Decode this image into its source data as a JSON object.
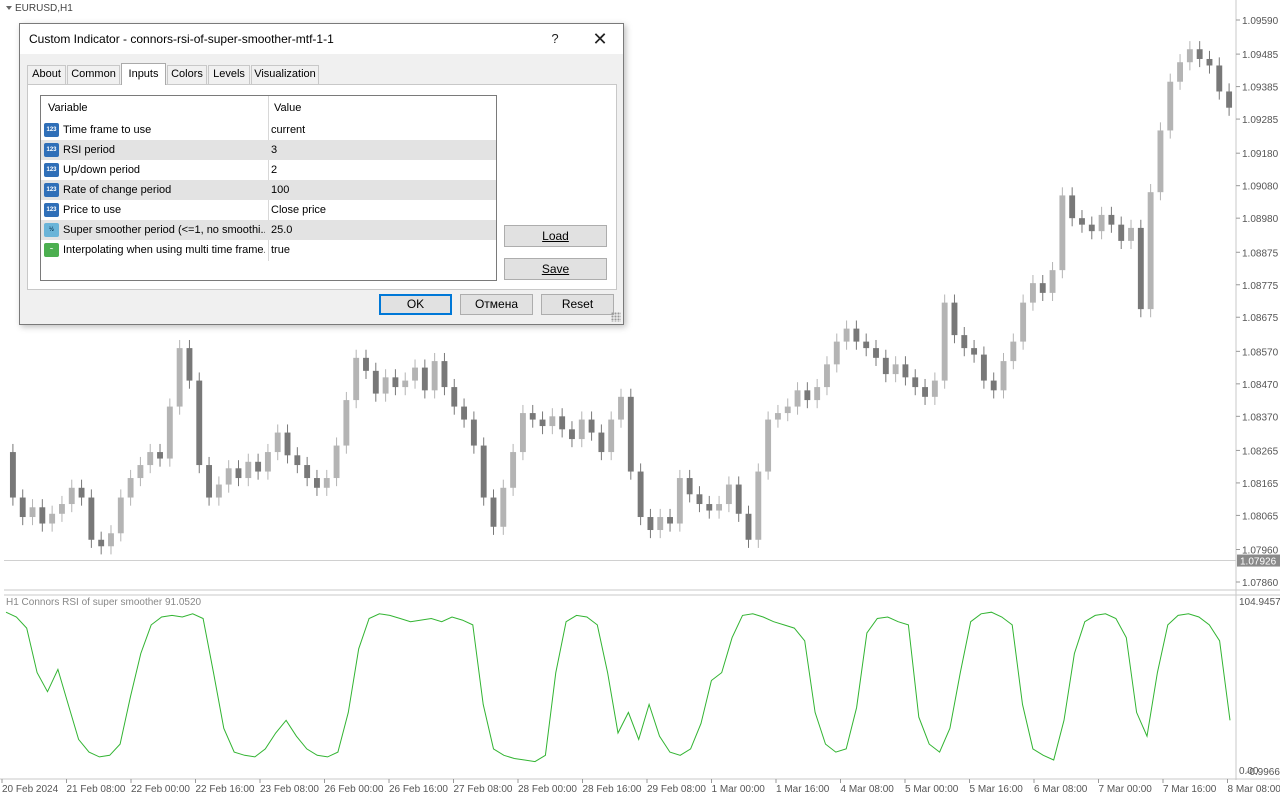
{
  "chart": {
    "symbol_label": "EURUSD,H1",
    "indicator_label": "H1 Connors RSI of super smoother 91.0520",
    "current_price": "1.07926",
    "price_min": 1.0786,
    "price_max": 1.0959,
    "candles": [
      [
        1.0826,
        1.0812
      ],
      [
        1.0812,
        1.0806
      ],
      [
        1.0806,
        1.0809
      ],
      [
        1.0809,
        1.0804
      ],
      [
        1.0804,
        1.0807
      ],
      [
        1.0807,
        1.081
      ],
      [
        1.081,
        1.0815
      ],
      [
        1.0815,
        1.0812
      ],
      [
        1.0812,
        1.0799
      ],
      [
        1.0799,
        1.0797
      ],
      [
        1.0797,
        1.0801
      ],
      [
        1.0801,
        1.0812
      ],
      [
        1.0812,
        1.0818
      ],
      [
        1.0818,
        1.0822
      ],
      [
        1.0822,
        1.0826
      ],
      [
        1.0826,
        1.0824
      ],
      [
        1.0824,
        1.084
      ],
      [
        1.084,
        1.0858
      ],
      [
        1.0858,
        1.0848
      ],
      [
        1.0848,
        1.0822
      ],
      [
        1.0822,
        1.0812
      ],
      [
        1.0812,
        1.0816
      ],
      [
        1.0816,
        1.0821
      ],
      [
        1.0821,
        1.0818
      ],
      [
        1.0818,
        1.0823
      ],
      [
        1.0823,
        1.082
      ],
      [
        1.082,
        1.0826
      ],
      [
        1.0826,
        1.0832
      ],
      [
        1.0832,
        1.0825
      ],
      [
        1.0825,
        1.0822
      ],
      [
        1.0822,
        1.0818
      ],
      [
        1.0818,
        1.0815
      ],
      [
        1.0815,
        1.0818
      ],
      [
        1.0818,
        1.0828
      ],
      [
        1.0828,
        1.0842
      ],
      [
        1.0842,
        1.0855
      ],
      [
        1.0855,
        1.0851
      ],
      [
        1.0851,
        1.0844
      ],
      [
        1.0844,
        1.0849
      ],
      [
        1.0849,
        1.0846
      ],
      [
        1.0846,
        1.0848
      ],
      [
        1.0848,
        1.0852
      ],
      [
        1.0852,
        1.0845
      ],
      [
        1.0845,
        1.0854
      ],
      [
        1.0854,
        1.0846
      ],
      [
        1.0846,
        1.084
      ],
      [
        1.084,
        1.0836
      ],
      [
        1.0836,
        1.0828
      ],
      [
        1.0828,
        1.0812
      ],
      [
        1.0812,
        1.0803
      ],
      [
        1.0803,
        1.0815
      ],
      [
        1.0815,
        1.0826
      ],
      [
        1.0826,
        1.0838
      ],
      [
        1.0838,
        1.0836
      ],
      [
        1.0836,
        1.0834
      ],
      [
        1.0834,
        1.0837
      ],
      [
        1.0837,
        1.0833
      ],
      [
        1.0833,
        1.083
      ],
      [
        1.083,
        1.0836
      ],
      [
        1.0836,
        1.0832
      ],
      [
        1.0832,
        1.0826
      ],
      [
        1.0826,
        1.0836
      ],
      [
        1.0836,
        1.0843
      ],
      [
        1.0843,
        1.082
      ],
      [
        1.082,
        1.0806
      ],
      [
        1.0806,
        1.0802
      ],
      [
        1.0802,
        1.0806
      ],
      [
        1.0806,
        1.0804
      ],
      [
        1.0804,
        1.0818
      ],
      [
        1.0818,
        1.0813
      ],
      [
        1.0813,
        1.081
      ],
      [
        1.081,
        1.0808
      ],
      [
        1.0808,
        1.081
      ],
      [
        1.081,
        1.0816
      ],
      [
        1.0816,
        1.0807
      ],
      [
        1.0807,
        1.0799
      ],
      [
        1.0799,
        1.082
      ],
      [
        1.082,
        1.0836
      ],
      [
        1.0836,
        1.0838
      ],
      [
        1.0838,
        1.084
      ],
      [
        1.084,
        1.0845
      ],
      [
        1.0845,
        1.0842
      ],
      [
        1.0842,
        1.0846
      ],
      [
        1.0846,
        1.0853
      ],
      [
        1.0853,
        1.086
      ],
      [
        1.086,
        1.0864
      ],
      [
        1.0864,
        1.086
      ],
      [
        1.086,
        1.0858
      ],
      [
        1.0858,
        1.0855
      ],
      [
        1.0855,
        1.085
      ],
      [
        1.085,
        1.0853
      ],
      [
        1.0853,
        1.0849
      ],
      [
        1.0849,
        1.0846
      ],
      [
        1.0846,
        1.0843
      ],
      [
        1.0843,
        1.0848
      ],
      [
        1.0848,
        1.0872
      ],
      [
        1.0872,
        1.0862
      ],
      [
        1.0862,
        1.0858
      ],
      [
        1.0858,
        1.0856
      ],
      [
        1.0856,
        1.0848
      ],
      [
        1.0848,
        1.0845
      ],
      [
        1.0845,
        1.0854
      ],
      [
        1.0854,
        1.086
      ],
      [
        1.086,
        1.0872
      ],
      [
        1.0872,
        1.0878
      ],
      [
        1.0878,
        1.0875
      ],
      [
        1.0875,
        1.0882
      ],
      [
        1.0882,
        1.0905
      ],
      [
        1.0905,
        1.0898
      ],
      [
        1.0898,
        1.0896
      ],
      [
        1.0896,
        1.0894
      ],
      [
        1.0894,
        1.0899
      ],
      [
        1.0899,
        1.0896
      ],
      [
        1.0896,
        1.0891
      ],
      [
        1.0891,
        1.0895
      ],
      [
        1.0895,
        1.087
      ],
      [
        1.087,
        1.0906
      ],
      [
        1.0906,
        1.0925
      ],
      [
        1.0925,
        1.094
      ],
      [
        1.094,
        1.0946
      ],
      [
        1.0946,
        1.095
      ],
      [
        1.095,
        1.0947
      ],
      [
        1.0947,
        1.0945
      ],
      [
        1.0945,
        1.0937
      ],
      [
        1.0937,
        1.0932
      ]
    ],
    "rsi": [
      98,
      95,
      88,
      60,
      48,
      62,
      40,
      18,
      10,
      7,
      8,
      15,
      45,
      72,
      90,
      95,
      96,
      95,
      97,
      94,
      60,
      25,
      10,
      8,
      7,
      12,
      22,
      30,
      20,
      12,
      8,
      7,
      10,
      35,
      75,
      94,
      97,
      96,
      94,
      92,
      93,
      94,
      92,
      95,
      93,
      90,
      40,
      12,
      8,
      6,
      5,
      4,
      8,
      60,
      92,
      96,
      95,
      90,
      60,
      22,
      35,
      18,
      40,
      20,
      10,
      8,
      12,
      28,
      55,
      60,
      82,
      96,
      97,
      95,
      92,
      90,
      88,
      80,
      35,
      15,
      10,
      12,
      38,
      85,
      94,
      95,
      92,
      90,
      32,
      15,
      10,
      25,
      60,
      92,
      97,
      98,
      95,
      90,
      40,
      12,
      8,
      5,
      30,
      72,
      92,
      96,
      97,
      94,
      82,
      35,
      20,
      60,
      90,
      96,
      97,
      95,
      90,
      80,
      30
    ],
    "x_labels": [
      "20 Feb 2024",
      "21 Feb 08:00",
      "22 Feb 00:00",
      "22 Feb 16:00",
      "23 Feb 08:00",
      "26 Feb 00:00",
      "26 Feb 16:00",
      "27 Feb 08:00",
      "28 Feb 00:00",
      "28 Feb 16:00",
      "29 Feb 08:00",
      "1 Mar 00:00",
      "1 Mar 16:00",
      "4 Mar 08:00",
      "5 Mar 00:00",
      "5 Mar 16:00",
      "6 Mar 08:00",
      "7 Mar 00:00",
      "7 Mar 16:00",
      "8 Mar 08:00"
    ],
    "y_labels": [
      "1.09590",
      "1.09485",
      "1.09385",
      "1.09285",
      "1.09180",
      "1.09080",
      "1.08980",
      "1.08875",
      "1.08775",
      "1.08675",
      "1.08570",
      "1.08470",
      "1.08370",
      "1.08265",
      "1.08165",
      "1.08065",
      "1.07960",
      "1.07860"
    ],
    "ind_y_top": "104.9457",
    "ind_y_bottom": "0.00",
    "ind_y_bottom2": "-0.9966",
    "colors": {
      "bull": "#b4b4b4",
      "bear": "#787878",
      "rsi_line": "#32b432"
    }
  },
  "dialog": {
    "title": "Custom Indicator - connors-rsi-of-super-smoother-mtf-1-1",
    "help": "?",
    "close": "✕",
    "tabs": [
      "About",
      "Common",
      "Inputs",
      "Colors",
      "Levels",
      "Visualization"
    ],
    "active_tab": "Inputs",
    "grid": {
      "col_variable": "Variable",
      "col_value": "Value",
      "rows": [
        {
          "icon": "123",
          "name": "Time frame to use",
          "value": "current"
        },
        {
          "icon": "123",
          "name": "RSI period",
          "value": "3"
        },
        {
          "icon": "123",
          "name": "Up/down period",
          "value": "2"
        },
        {
          "icon": "123",
          "name": "Rate of change period",
          "value": "100"
        },
        {
          "icon": "123",
          "name": "Price to use",
          "value": "Close price"
        },
        {
          "icon": "½",
          "name": "Super smoother period (<=1, no smoothi...",
          "value": "25.0"
        },
        {
          "icon": "~",
          "name": "Interpolating when using multi time frame...",
          "value": "true"
        }
      ]
    },
    "load_label": "Load",
    "save_label": "Save",
    "ok_label": "OK",
    "cancel_label": "Отмена",
    "reset_label": "Reset"
  }
}
